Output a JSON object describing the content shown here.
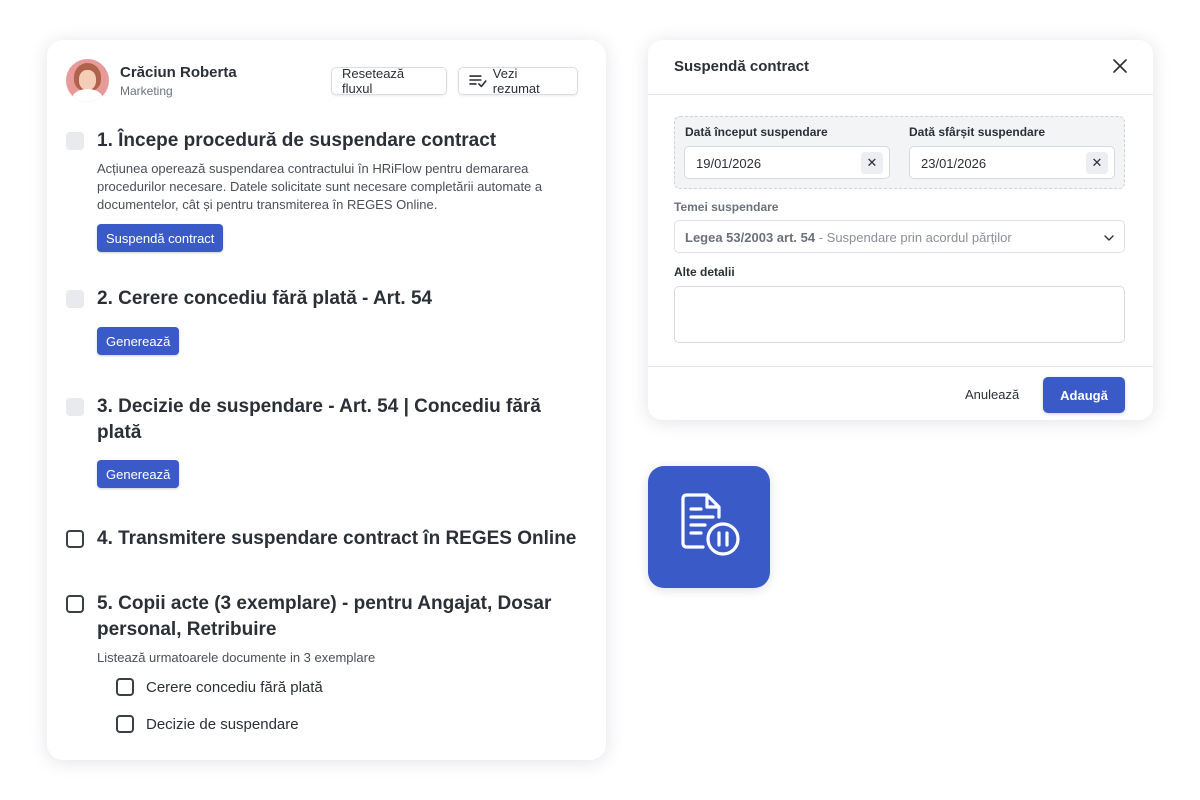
{
  "profile": {
    "name": "Crăciun Roberta",
    "department": "Marketing"
  },
  "toolbar": {
    "reset_label": "Resetează fluxul",
    "summary_label": "Vezi rezumat"
  },
  "steps": [
    {
      "title": "1. Începe procedură de suspendare contract",
      "description_lines": [
        "Acțiunea operează suspendarea contractului în HRiFlow pentru demararea",
        "procedurilor necesare. Datele solicitate sunt necesare completării automate a",
        "documentelor, cât și pentru transmiterea în REGES Online."
      ],
      "button": "Suspendă contract"
    },
    {
      "title": "2. Cerere concediu fără plată - Art. 54",
      "button": "Generează"
    },
    {
      "title_lines": [
        "3. Decizie de suspendare - Art. 54 | Concediu fără",
        "plată"
      ],
      "button": "Generează"
    },
    {
      "title": "4. Transmitere suspendare contract în REGES Online"
    },
    {
      "title_lines": [
        "5. Copii acte (3 exemplare) - pentru Angajat, Dosar",
        "personal, Retribuire"
      ],
      "description": "Listează urmatoarele documente in 3 exemplare",
      "subitems": [
        "Cerere concediu fără plată",
        "Decizie de suspendare"
      ]
    }
  ],
  "modal": {
    "title": "Suspendă contract",
    "start_label": "Dată început suspendare",
    "start_value": "19/01/2026",
    "end_label": "Dată sfârșit suspendare",
    "end_value": "23/01/2026",
    "clear_symbol": "✕",
    "reason_label": "Temei suspendare",
    "reason_value_bold": "Legea 53/2003 art. 54",
    "reason_value_rest": " - Suspendare prin acordul părților",
    "details_label": "Alte detalii",
    "details_value": "",
    "cancel_label": "Anulează",
    "submit_label": "Adaugă"
  },
  "colors": {
    "primary": "#3a5bc7",
    "text": "#2b2f36",
    "disabled_check": "#e8eaed"
  },
  "icons": {
    "feature_tile": "document-pause-icon",
    "close": "close-icon",
    "summary": "list-check-icon",
    "select": "chevron-down-icon"
  }
}
